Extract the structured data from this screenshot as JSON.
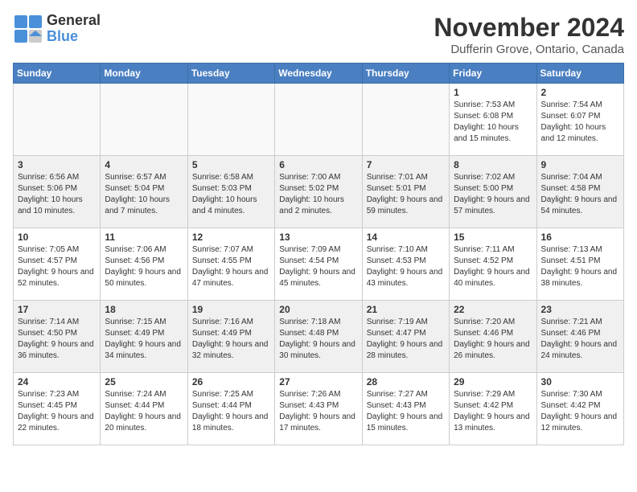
{
  "header": {
    "logo_line1": "General",
    "logo_line2": "Blue",
    "month": "November 2024",
    "location": "Dufferin Grove, Ontario, Canada"
  },
  "calendar": {
    "days_of_week": [
      "Sunday",
      "Monday",
      "Tuesday",
      "Wednesday",
      "Thursday",
      "Friday",
      "Saturday"
    ],
    "weeks": [
      [
        {
          "day": "",
          "empty": true
        },
        {
          "day": "",
          "empty": true
        },
        {
          "day": "",
          "empty": true
        },
        {
          "day": "",
          "empty": true
        },
        {
          "day": "",
          "empty": true
        },
        {
          "day": "1",
          "info": "Sunrise: 7:53 AM\nSunset: 6:08 PM\nDaylight: 10 hours and 15 minutes."
        },
        {
          "day": "2",
          "info": "Sunrise: 7:54 AM\nSunset: 6:07 PM\nDaylight: 10 hours and 12 minutes."
        }
      ],
      [
        {
          "day": "3",
          "info": "Sunrise: 6:56 AM\nSunset: 5:06 PM\nDaylight: 10 hours and 10 minutes."
        },
        {
          "day": "4",
          "info": "Sunrise: 6:57 AM\nSunset: 5:04 PM\nDaylight: 10 hours and 7 minutes."
        },
        {
          "day": "5",
          "info": "Sunrise: 6:58 AM\nSunset: 5:03 PM\nDaylight: 10 hours and 4 minutes."
        },
        {
          "day": "6",
          "info": "Sunrise: 7:00 AM\nSunset: 5:02 PM\nDaylight: 10 hours and 2 minutes."
        },
        {
          "day": "7",
          "info": "Sunrise: 7:01 AM\nSunset: 5:01 PM\nDaylight: 9 hours and 59 minutes."
        },
        {
          "day": "8",
          "info": "Sunrise: 7:02 AM\nSunset: 5:00 PM\nDaylight: 9 hours and 57 minutes."
        },
        {
          "day": "9",
          "info": "Sunrise: 7:04 AM\nSunset: 4:58 PM\nDaylight: 9 hours and 54 minutes."
        }
      ],
      [
        {
          "day": "10",
          "info": "Sunrise: 7:05 AM\nSunset: 4:57 PM\nDaylight: 9 hours and 52 minutes."
        },
        {
          "day": "11",
          "info": "Sunrise: 7:06 AM\nSunset: 4:56 PM\nDaylight: 9 hours and 50 minutes."
        },
        {
          "day": "12",
          "info": "Sunrise: 7:07 AM\nSunset: 4:55 PM\nDaylight: 9 hours and 47 minutes."
        },
        {
          "day": "13",
          "info": "Sunrise: 7:09 AM\nSunset: 4:54 PM\nDaylight: 9 hours and 45 minutes."
        },
        {
          "day": "14",
          "info": "Sunrise: 7:10 AM\nSunset: 4:53 PM\nDaylight: 9 hours and 43 minutes."
        },
        {
          "day": "15",
          "info": "Sunrise: 7:11 AM\nSunset: 4:52 PM\nDaylight: 9 hours and 40 minutes."
        },
        {
          "day": "16",
          "info": "Sunrise: 7:13 AM\nSunset: 4:51 PM\nDaylight: 9 hours and 38 minutes."
        }
      ],
      [
        {
          "day": "17",
          "info": "Sunrise: 7:14 AM\nSunset: 4:50 PM\nDaylight: 9 hours and 36 minutes."
        },
        {
          "day": "18",
          "info": "Sunrise: 7:15 AM\nSunset: 4:49 PM\nDaylight: 9 hours and 34 minutes."
        },
        {
          "day": "19",
          "info": "Sunrise: 7:16 AM\nSunset: 4:49 PM\nDaylight: 9 hours and 32 minutes."
        },
        {
          "day": "20",
          "info": "Sunrise: 7:18 AM\nSunset: 4:48 PM\nDaylight: 9 hours and 30 minutes."
        },
        {
          "day": "21",
          "info": "Sunrise: 7:19 AM\nSunset: 4:47 PM\nDaylight: 9 hours and 28 minutes."
        },
        {
          "day": "22",
          "info": "Sunrise: 7:20 AM\nSunset: 4:46 PM\nDaylight: 9 hours and 26 minutes."
        },
        {
          "day": "23",
          "info": "Sunrise: 7:21 AM\nSunset: 4:46 PM\nDaylight: 9 hours and 24 minutes."
        }
      ],
      [
        {
          "day": "24",
          "info": "Sunrise: 7:23 AM\nSunset: 4:45 PM\nDaylight: 9 hours and 22 minutes."
        },
        {
          "day": "25",
          "info": "Sunrise: 7:24 AM\nSunset: 4:44 PM\nDaylight: 9 hours and 20 minutes."
        },
        {
          "day": "26",
          "info": "Sunrise: 7:25 AM\nSunset: 4:44 PM\nDaylight: 9 hours and 18 minutes."
        },
        {
          "day": "27",
          "info": "Sunrise: 7:26 AM\nSunset: 4:43 PM\nDaylight: 9 hours and 17 minutes."
        },
        {
          "day": "28",
          "info": "Sunrise: 7:27 AM\nSunset: 4:43 PM\nDaylight: 9 hours and 15 minutes."
        },
        {
          "day": "29",
          "info": "Sunrise: 7:29 AM\nSunset: 4:42 PM\nDaylight: 9 hours and 13 minutes."
        },
        {
          "day": "30",
          "info": "Sunrise: 7:30 AM\nSunset: 4:42 PM\nDaylight: 9 hours and 12 minutes."
        }
      ]
    ]
  }
}
